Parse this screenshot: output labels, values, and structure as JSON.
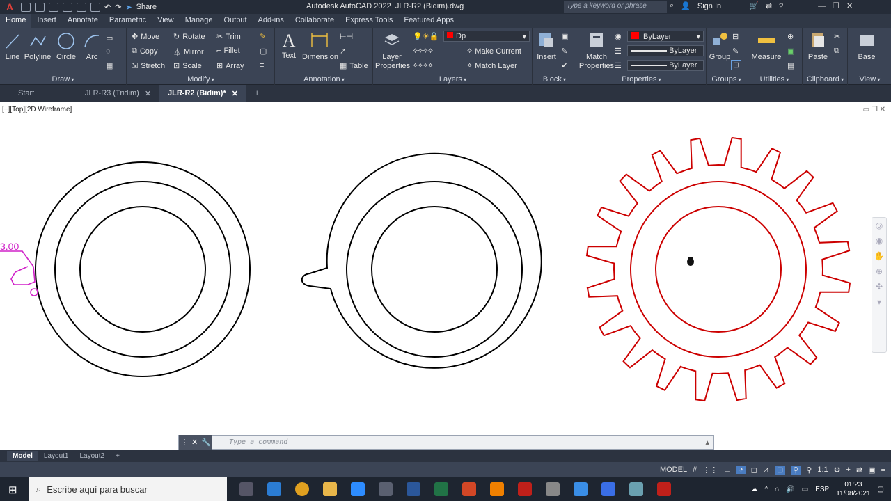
{
  "titlebar": {
    "app_title": "Autodesk AutoCAD 2022",
    "file_name": "JLR-R2 (Bidim).dwg",
    "share": "Share",
    "search_placeholder": "Type a keyword or phrase",
    "sign_in": "Sign In"
  },
  "ribbon_tabs": [
    "Home",
    "Insert",
    "Annotate",
    "Parametric",
    "View",
    "Manage",
    "Output",
    "Add-ins",
    "Collaborate",
    "Express Tools",
    "Featured Apps"
  ],
  "draw": {
    "title": "Draw",
    "line": "Line",
    "polyline": "Polyline",
    "circle": "Circle",
    "arc": "Arc"
  },
  "modify": {
    "title": "Modify",
    "move": "Move",
    "rotate": "Rotate",
    "trim": "Trim",
    "copy": "Copy",
    "mirror": "Mirror",
    "fillet": "Fillet",
    "stretch": "Stretch",
    "scale": "Scale",
    "array": "Array"
  },
  "annotation": {
    "title": "Annotation",
    "text": "Text",
    "dimension": "Dimension",
    "table": "Table"
  },
  "layers": {
    "title": "Layers",
    "layer_properties_1": "Layer",
    "layer_properties_2": "Properties",
    "current_layer": "Dp",
    "make_current": "Make Current",
    "match_layer": "Match Layer"
  },
  "block": {
    "title": "Block",
    "insert": "Insert"
  },
  "properties": {
    "title": "Properties",
    "match_1": "Match",
    "match_2": "Properties",
    "color": "ByLayer",
    "linetype": "ByLayer",
    "lineweight": "ByLayer"
  },
  "groups": {
    "title": "Groups",
    "group": "Group"
  },
  "utilities": {
    "title": "Utilities",
    "measure": "Measure"
  },
  "clipboard": {
    "title": "Clipboard",
    "paste": "Paste"
  },
  "view": {
    "title": "View",
    "base": "Base"
  },
  "doc_tabs": [
    {
      "label": "Start"
    },
    {
      "label": "JLR-R3 (Tridim)"
    },
    {
      "label": "JLR-R2 (Bidim)*"
    }
  ],
  "viewport_label": "[−][Top][2D Wireframe]",
  "dimension_text": "3.00",
  "command_placeholder": "Type a command",
  "layout_tabs": [
    "Model",
    "Layout1",
    "Layout2"
  ],
  "status": {
    "model": "MODEL",
    "scale": "1:1"
  },
  "taskbar": {
    "search": "Escribe aquí para buscar",
    "lang": "ESP",
    "time": "01:23",
    "date": "11/08/2021"
  },
  "colors": {
    "gear": "#cc0000",
    "dimension": "#d020c8",
    "ribbon": "#3b4455",
    "titlebar": "#252c38"
  }
}
